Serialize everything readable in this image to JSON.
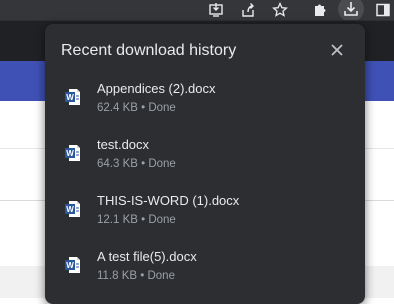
{
  "toolbar": {
    "icons": [
      "install-app-icon",
      "share-icon",
      "bookmark-star-icon",
      "extensions-icon",
      "download-icon",
      "side-panel-icon"
    ]
  },
  "colors": {
    "bubble_bg": "#2d2e31",
    "text_primary": "#e8eaed",
    "text_secondary": "#9aa0a6",
    "word_blue": "#2b579a",
    "page_accent": "#3f51b5"
  },
  "download_bubble": {
    "title": "Recent download history",
    "items": [
      {
        "name": "Appendices (2).docx",
        "meta": "62.4 KB • Done",
        "icon": "word-doc-icon"
      },
      {
        "name": "test.docx",
        "meta": "64.3 KB • Done",
        "icon": "word-doc-icon"
      },
      {
        "name": "THIS-IS-WORD (1).docx",
        "meta": "12.1 KB • Done",
        "icon": "word-doc-icon"
      },
      {
        "name": "A test file(5).docx",
        "meta": "11.8 KB • Done",
        "icon": "word-doc-icon"
      }
    ]
  }
}
